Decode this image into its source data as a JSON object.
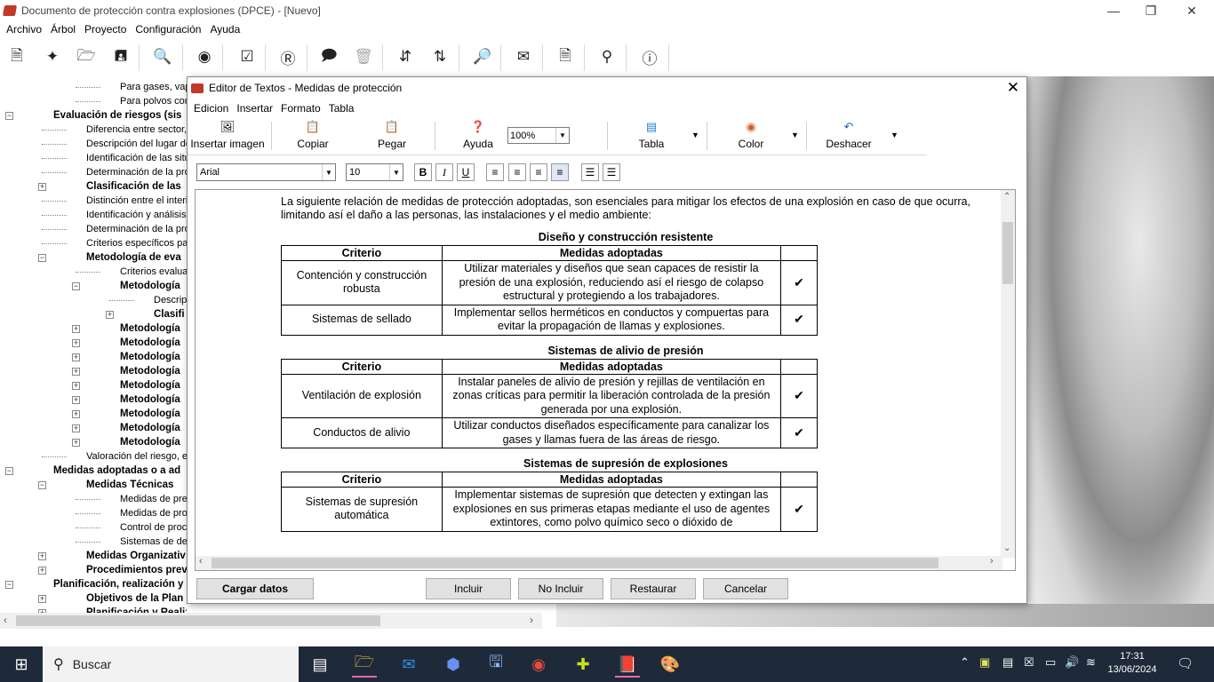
{
  "main_window": {
    "title": "Documento de protección contra explosiones (DPCE) - [Nuevo]",
    "menu": [
      "Archivo",
      "Árbol",
      "Proyecto",
      "Configuración",
      "Ayuda"
    ],
    "toolbar_icons": [
      "new-document-icon",
      "magic-wand-icon",
      "open-folder-icon",
      "save-icon",
      "preview-icon",
      "binoculars-icon",
      "checklist-icon",
      "r-report-icon",
      "comment-icon",
      "trash-icon",
      "sort-ascending-icon",
      "sort-descending-icon",
      "search-document-icon",
      "envelope-icon",
      "pdf-icon",
      "location-pin-icon",
      "help-icon"
    ]
  },
  "tree": {
    "items": [
      {
        "text": "Para gases, vapores o n",
        "level": 3,
        "bold": false
      },
      {
        "text": "Para polvos combustible",
        "level": 3,
        "bold": false
      },
      {
        "text": "Evaluación de riesgos (sis",
        "level": 1,
        "bold": true,
        "expander": "−"
      },
      {
        "text": "Diferencia entre sector,",
        "level": 2,
        "bold": false
      },
      {
        "text": "Descripción del lugar do",
        "level": 2,
        "bold": false
      },
      {
        "text": "Identificación de las situ",
        "level": 2,
        "bold": false
      },
      {
        "text": "Determinación de la pro",
        "level": 2,
        "bold": false
      },
      {
        "text": "Clasificación de las",
        "level": 2,
        "bold": true,
        "expander": "+"
      },
      {
        "text": "Distinción entre el interi",
        "level": 2,
        "bold": false
      },
      {
        "text": "Identificación y análisis",
        "level": 2,
        "bold": false
      },
      {
        "text": "Determinación de la pro",
        "level": 2,
        "bold": false
      },
      {
        "text": "Criterios específicos par",
        "level": 2,
        "bold": false
      },
      {
        "text": "Metodología de eva",
        "level": 2,
        "bold": true,
        "expander": "−"
      },
      {
        "text": "Criterios evalua",
        "level": 3,
        "bold": false
      },
      {
        "text": "Metodología",
        "level": 3,
        "bold": true,
        "expander": "−"
      },
      {
        "text": "Descrip",
        "level": 4,
        "bold": false
      },
      {
        "text": "Clasifi",
        "level": 4,
        "bold": true,
        "expander": "+"
      },
      {
        "text": "Metodología",
        "level": 3,
        "bold": true,
        "expander": "+"
      },
      {
        "text": "Metodología",
        "level": 3,
        "bold": true,
        "expander": "+"
      },
      {
        "text": "Metodología",
        "level": 3,
        "bold": true,
        "expander": "+"
      },
      {
        "text": "Metodología",
        "level": 3,
        "bold": true,
        "expander": "+"
      },
      {
        "text": "Metodología",
        "level": 3,
        "bold": true,
        "expander": "+"
      },
      {
        "text": "Metodología",
        "level": 3,
        "bold": true,
        "expander": "+"
      },
      {
        "text": "Metodología",
        "level": 3,
        "bold": true,
        "expander": "+"
      },
      {
        "text": "Metodología",
        "level": 3,
        "bold": true,
        "expander": "+"
      },
      {
        "text": "Metodología",
        "level": 3,
        "bold": true,
        "expander": "+"
      },
      {
        "text": "Valoración del riesgo, e",
        "level": 2,
        "bold": false
      },
      {
        "text": "Medidas adoptadas o a ad",
        "level": 1,
        "bold": true,
        "expander": "−"
      },
      {
        "text": "Medidas Técnicas",
        "level": 2,
        "bold": true,
        "expander": "−"
      },
      {
        "text": "Medidas de pre",
        "level": 3,
        "bold": false
      },
      {
        "text": "Medidas de pro",
        "level": 3,
        "bold": false
      },
      {
        "text": "Control de proc",
        "level": 3,
        "bold": false
      },
      {
        "text": "Sistemas de det",
        "level": 3,
        "bold": false
      },
      {
        "text": "Medidas Organizativ",
        "level": 2,
        "bold": true,
        "expander": "+"
      },
      {
        "text": "Procedimientos prev",
        "level": 2,
        "bold": true,
        "expander": "+"
      },
      {
        "text": "Planificación, realización y",
        "level": 1,
        "bold": true,
        "expander": "−"
      },
      {
        "text": "Objetivos de la Plan",
        "level": 2,
        "bold": true,
        "expander": "+"
      },
      {
        "text": "Planificación y Realización",
        "level": 2,
        "bold": true,
        "expander": "+"
      }
    ]
  },
  "dialog": {
    "title": "Editor de Textos - Medidas de protección",
    "menu": [
      "Edicion",
      "Insertar",
      "Formato",
      "Tabla"
    ],
    "toolbar": {
      "insert_image": "Insertar imagen",
      "copy": "Copiar",
      "paste": "Pegar",
      "help": "Ayuda",
      "zoom": "100%",
      "table": "Tabla",
      "color": "Color",
      "undo": "Deshacer"
    },
    "format": {
      "font": "Arial",
      "size": "10",
      "bold": "B",
      "italic": "I",
      "underline": "U"
    },
    "content": {
      "intro": "La siguiente relación de medidas de protección adoptadas, son esenciales para mitigar los efectos de una explosión en caso de que ocurra, limitando así el daño a las personas, las instalaciones y el medio ambiente:",
      "col_criterio": "Criterio",
      "col_medidas": "Medidas adoptadas",
      "check": "✔",
      "sections": [
        {
          "title": "Diseño y construcción resistente",
          "rows": [
            {
              "criterio": "Contención y construcción robusta",
              "medida": "Utilizar materiales y diseños que sean capaces de resistir la presión de una explosión, reduciendo así el riesgo de colapso estructural y protegiendo a los trabajadores."
            },
            {
              "criterio": "Sistemas de sellado",
              "medida": "Implementar sellos herméticos en conductos y compuertas para evitar la propagación de llamas y explosiones."
            }
          ]
        },
        {
          "title": "Sistemas de alivio de presión",
          "rows": [
            {
              "criterio": "Ventilación de explosión",
              "medida": "Instalar paneles de alivio de presión y rejillas de ventilación en zonas críticas para permitir la liberación controlada de la presión generada por una explosión."
            },
            {
              "criterio": "Conductos de alivio",
              "medida": "Utilizar conductos diseñados específicamente para canalizar los gases y llamas fuera de las áreas de riesgo."
            }
          ]
        },
        {
          "title": "Sistemas de supresión de explosiones",
          "rows": [
            {
              "criterio": "Sistemas de supresión automática",
              "medida": "Implementar sistemas de supresión que detecten y extingan las explosiones en sus primeras etapas mediante el uso de agentes extintores, como polvo químico seco o dióxido de"
            }
          ]
        }
      ]
    },
    "buttons": {
      "load": "Cargar datos",
      "include": "Incluir",
      "not_include": "No Incluir",
      "restore": "Restaurar",
      "cancel": "Cancelar"
    }
  },
  "taskbar": {
    "search": "Buscar",
    "time": "17:31",
    "date": "13/06/2024"
  }
}
